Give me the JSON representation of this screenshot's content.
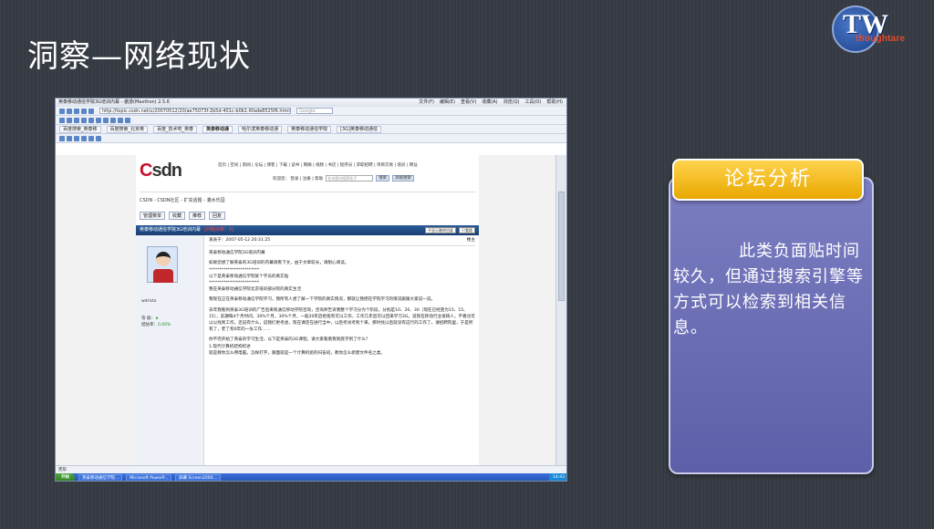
{
  "slide": {
    "title": "洞察—网络现状"
  },
  "logo": {
    "mark": "TW",
    "wordmark": "thoughtare"
  },
  "browser": {
    "window_title": "英泰移动通信学院3G培训内幕 - 傲游(Maxthon) 2.5.6",
    "menus": [
      "文件(F)",
      "编辑(E)",
      "查看(V)",
      "收藏(A)",
      "浏览(Q)",
      "工具(O)",
      "帮助(H)"
    ],
    "address": "http://topic.csdn.net/u/20070512/20/ae75073f-2b5d-401c-b0b1-6fade8525f6.html",
    "search_placeholder": "Google",
    "tabs": [
      "百度搜索_英泰移",
      "百度搜索_北京英",
      "百度_技术吧_英泰",
      "英泰移动通",
      "哈尔滨英泰移动通",
      "英泰移动通信学院",
      "[3G]英泰移动通信"
    ],
    "status_text": "完毕",
    "taskbar": {
      "start": "开始",
      "tasks": [
        "英泰移动通信学院...",
        "Microsoft PowerP...",
        "屏幕 Screen2000..."
      ],
      "clock": "14:43"
    }
  },
  "csdn": {
    "logo_c": "C",
    "logo_rest": "sdn",
    "topnav": "首页 | 空间 | 新闻 | 论坛 | 博客 | 下载 | 读书 | 网摘 | 视频 | 书店 | 程序员 | 求职招聘 | 项目交易 | 培训 | 网址",
    "welcome": "欢迎您：  登录  |  注册  |  帮助",
    "search_placeholder": "在本版内搜索帖子",
    "search_btn": "搜索",
    "adv_btn": "高级搜索",
    "crumb": "CSDN - CSDN社区 - 扩充话题 - 灌水乐园",
    "actions": [
      "管理菜单",
      "收藏",
      "推荐",
      "回复"
    ],
    "thread_title": "英泰移动通信学院3G培训内幕",
    "thread_tag": "[问题点数：0]",
    "sort_label": "不显示删除回复",
    "sort_btn": "只看楼",
    "user": {
      "name": "wdrista",
      "level": "等 级：",
      "level_value": "★",
      "rate_label": "结帖率：",
      "rate": "0.00%"
    },
    "post": {
      "meta_left": "发表于：2007-05-12 20:31:25",
      "meta_right": "楼主",
      "heading": "英泰移动通信学院3G培训内幕",
      "lines": [
        "如果您想了解英泰的3G培训的内幕请看下文，由于文章较长，请耐心阅读。",
        "************************",
        "以下是英泰移动通信学院某个学员的真实贴",
        "************************",
        "我在英泰移动通信学院北京培训部分院的真实生活",
        "我现在正在英泰移动通信学院学习，我所有人想了解一下学院的真实情况，那就让我把在学院学习的情况跟跟大家说一说。",
        "去年我看到英泰3G培训的广告后来到通信移动学院咨询，咨询师告诉我整个学习分为个阶段，分别是10、20、30（现在已经变为15、15、15），前期每4个月时间，30%个月，30%个月，一般20年后拒能有可以工作，工作几年后可以回来学习3G。说现在移动行业很缺人，不看也可以以找到工作，还说有什么，说我们更考虑，现在课还在进行当中，以后考试考到个来，那时找以后就没有这行的工作了，请招聘院里，于是所有了，老了有6年的一份工作……",
        "你不完开始了英泰的学习生活，以下是英泰的3G课程，请大家看看我到底学到了什么？",
        "1.现代计算机结构综述",
        "就是教你怎么用电脑，怎样打字，跟面就是一个计算机组的扫盲班，教你怎么新建文件名之类。"
      ]
    }
  },
  "card": {
    "header": "论坛分析",
    "body": "此类负面贴时间较久，但通过搜索引擎等方式可以检索到相关信息。"
  }
}
